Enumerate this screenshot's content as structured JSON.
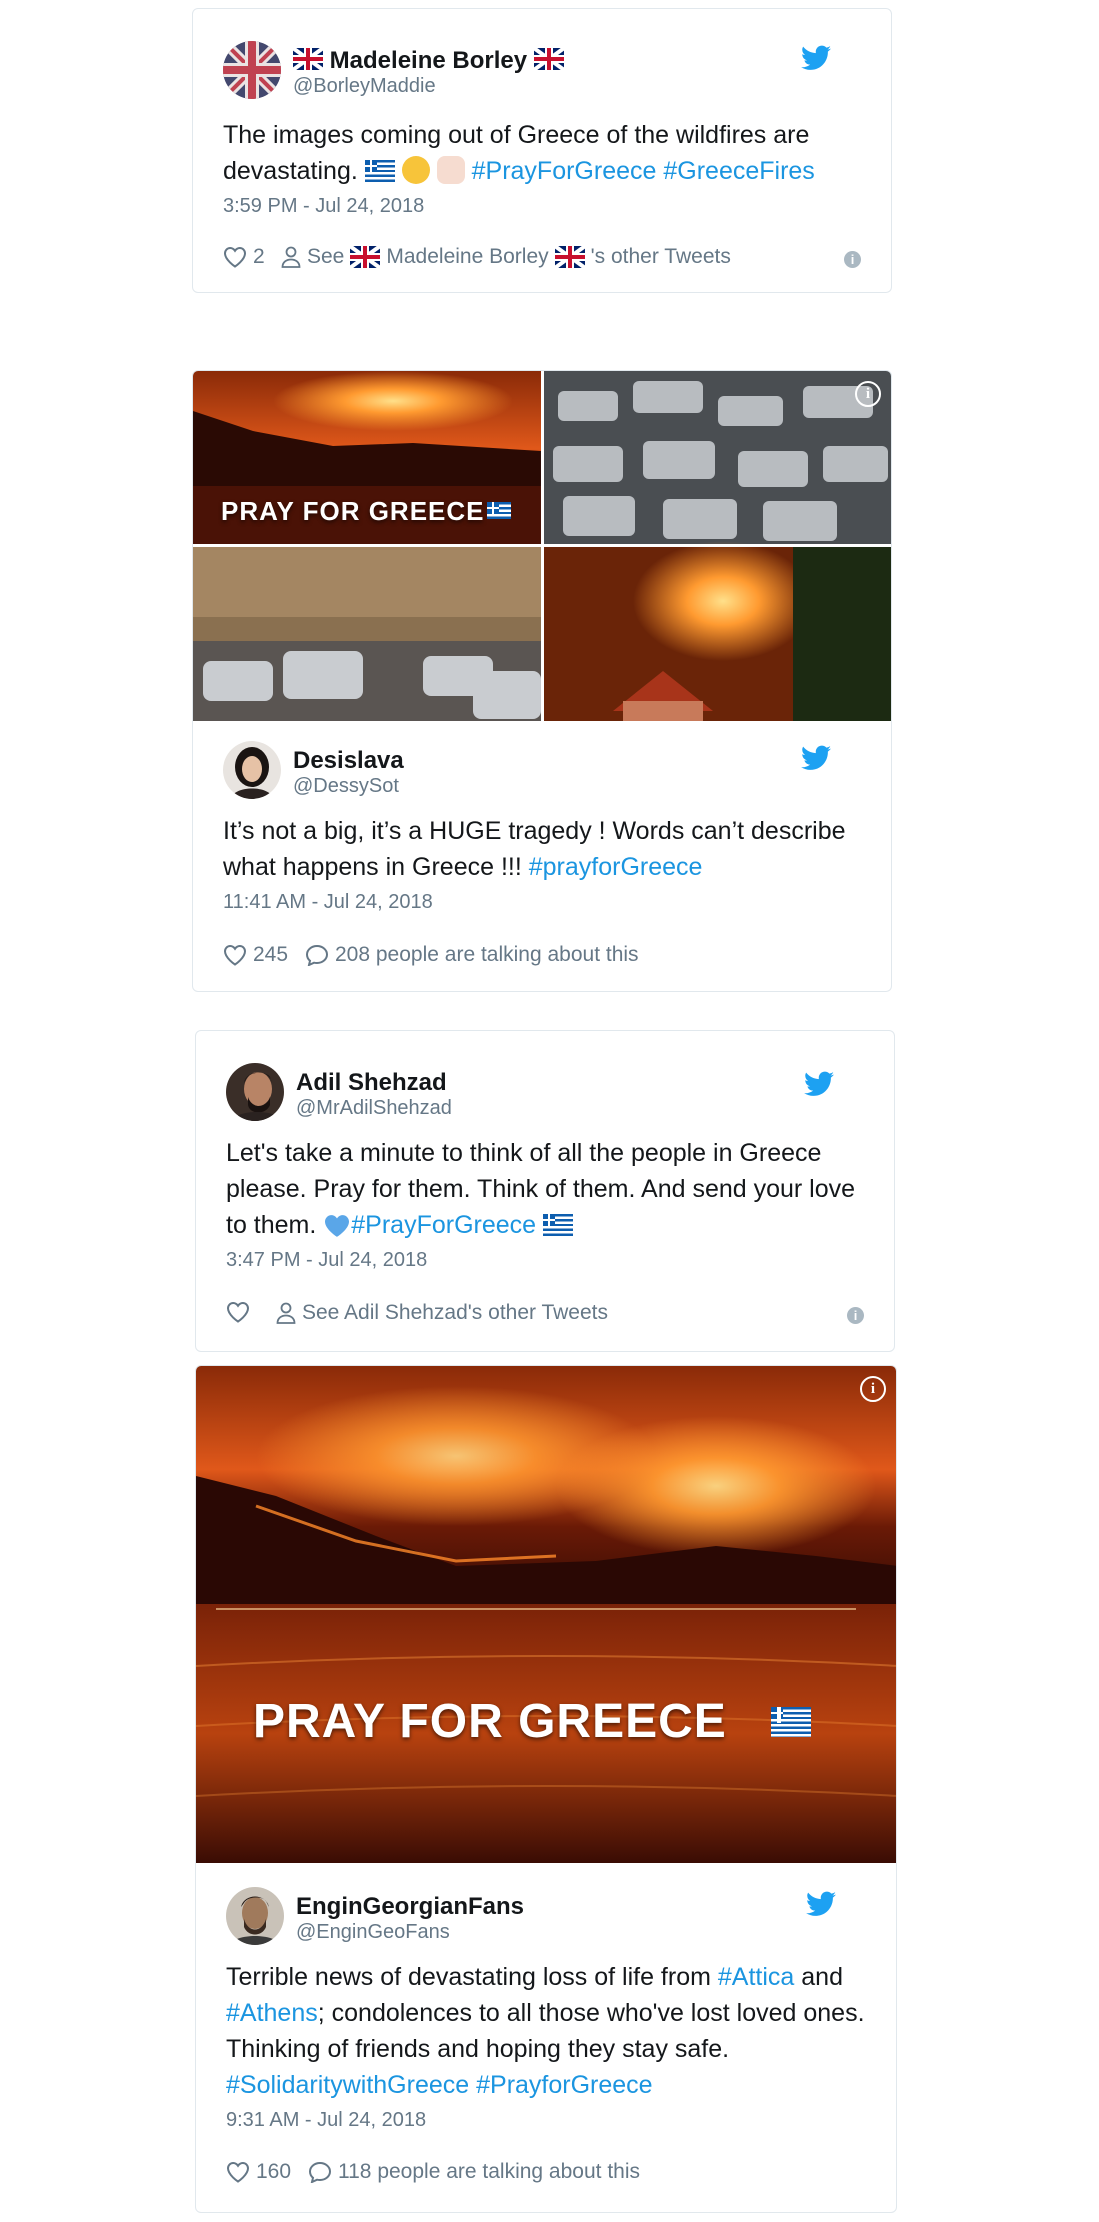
{
  "tweets": [
    {
      "name": "Madeleine Borley",
      "handle": "@BorleyMaddie",
      "text_a": "The images coming out of Greece of the wildfires are devastating. ",
      "hashtags": "#PrayForGreece #GreeceFires",
      "time": "3:59 PM - Jul 24, 2018",
      "likes": "2",
      "see_prefix": "See ",
      "see_name": "Madeleine Borley",
      "see_suffix": "'s other Tweets"
    },
    {
      "banner": "PRAY FOR GREECE",
      "name": "Desislava",
      "handle": "@DessySot",
      "text": "It’s not a big, it’s a HUGE tragedy ! Words can’t describe what happens in Greece !!! ",
      "hashtag": "#prayforGreece",
      "time": "11:41 AM - Jul 24, 2018",
      "likes": "245",
      "talking": "208 people are talking about this"
    },
    {
      "name": "Adil Shehzad",
      "handle": "@MrAdilShehzad",
      "text": "Let's take a minute to think of all the people in Greece please. Pray for them. Think of them. And send your love to them. ",
      "hashtag": "#PrayForGreece",
      "time": "3:47 PM - Jul 24, 2018",
      "see": "See Adil Shehzad's other Tweets"
    },
    {
      "banner": "PRAY FOR GREECE",
      "name": "EnginGeorgianFans",
      "handle": "@EnginGeoFans",
      "text_a": "Terrible news of devastating loss of life from ",
      "tag_attica": "#Attica",
      "text_b": " and ",
      "tag_athens": "#Athens",
      "text_c": "; condolences to all those who've lost loved ones. Thinking of friends and hoping they stay safe. ",
      "tags_end": "#SolidaritywithGreece #PrayforGreece",
      "time": "9:31 AM - Jul 24, 2018",
      "likes": "160",
      "talking": "118 people are talking about this"
    }
  ],
  "info_symbol": "i",
  "colors": {
    "twitter_blue": "#1da1f2",
    "link": "#1b95e0",
    "muted": "#657786",
    "border": "#e1e8ed"
  },
  "icons": [
    "twitter-bird-icon",
    "heart-icon",
    "person-icon",
    "comment-icon",
    "info-icon",
    "greece-flag-icon",
    "uk-flag-icon"
  ]
}
